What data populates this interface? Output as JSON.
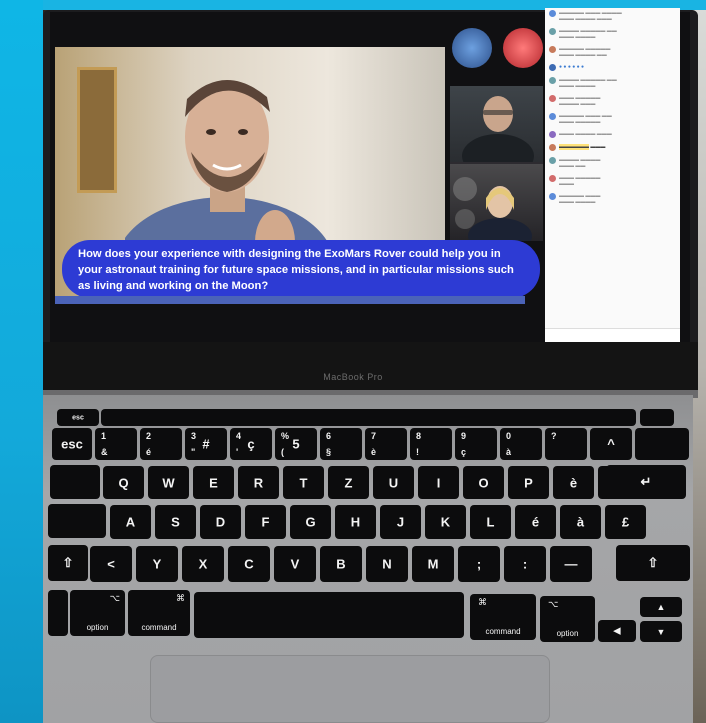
{
  "screen": {
    "caption": "How does your experience with designing the ExoMars Rover could help you in your astronaut training for future space missions, and in particular missions such as living and working on the Moon?"
  },
  "laptop": {
    "brand": "MacBook Pro"
  },
  "keyboard": {
    "row_numbers": [
      {
        "top": "",
        "bot": "",
        "main": "esc"
      },
      {
        "top": "1",
        "bot": "&",
        "main": ""
      },
      {
        "top": "2",
        "bot": "é",
        "main": ""
      },
      {
        "top": "3",
        "bot": "\"",
        "main": "#"
      },
      {
        "top": "4",
        "bot": "'",
        "main": "ç"
      },
      {
        "top": "%",
        "bot": "(",
        "main": "5"
      },
      {
        "top": "6",
        "bot": "§",
        "main": ""
      },
      {
        "top": "7",
        "bot": "è",
        "main": ""
      },
      {
        "top": "8",
        "bot": "!",
        "main": ""
      },
      {
        "top": "9",
        "bot": "ç",
        "main": ""
      },
      {
        "top": "0",
        "bot": "à",
        "main": ""
      },
      {
        "top": "?",
        "bot": "",
        "main": ""
      },
      {
        "top": "",
        "bot": "",
        "main": "^"
      }
    ],
    "row_q": [
      "Q",
      "W",
      "E",
      "R",
      "T",
      "Z",
      "U",
      "I",
      "O",
      "P",
      "è",
      "!"
    ],
    "row_a": [
      "A",
      "S",
      "D",
      "F",
      "G",
      "H",
      "J",
      "K",
      "L",
      "é",
      "à",
      "£"
    ],
    "row_y": [
      "<",
      "Y",
      "X",
      "C",
      "V",
      "B",
      "N",
      "M",
      ";",
      ":",
      "—"
    ],
    "mods": {
      "option": "option",
      "command": "command",
      "cmd_symbol": "⌘",
      "opt_symbol": "⌥"
    }
  }
}
